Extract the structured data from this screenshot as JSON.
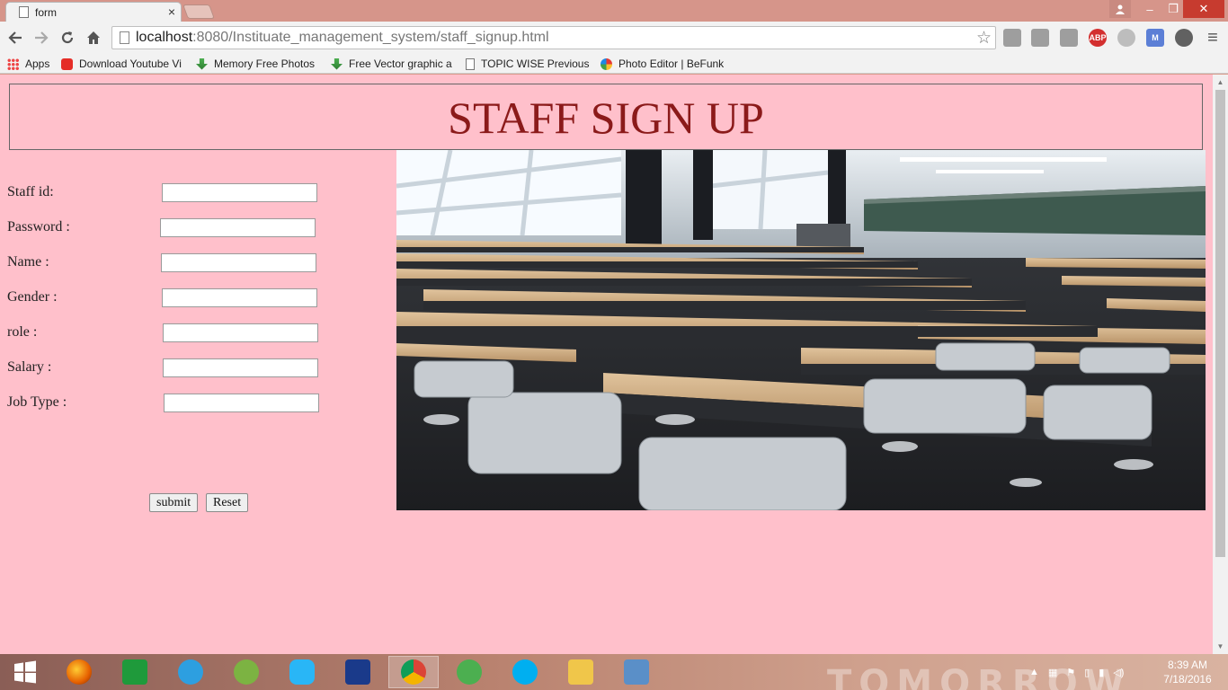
{
  "browser": {
    "tab_title": "form",
    "tab_close": "×",
    "url_host": "localhost",
    "url_path": ":8080/Instituate_management_system/staff_signup.html",
    "window_controls": {
      "minimize": "–",
      "maximize": "❐",
      "close": "✕"
    }
  },
  "bookmarks": [
    {
      "label": "Apps",
      "icon": "apps-icon"
    },
    {
      "label": "Download Youtube Vi",
      "icon": "youtube-icon"
    },
    {
      "label": "Memory Free Photos",
      "icon": "download-icon"
    },
    {
      "label": "Free Vector graphic a",
      "icon": "download-icon"
    },
    {
      "label": "TOPIC WISE Previous",
      "icon": "page-icon"
    },
    {
      "label": "Photo Editor | BeFunk",
      "icon": "befunky-icon"
    }
  ],
  "extensions": [
    {
      "name": "office-icon",
      "label": "",
      "color": "#9e9e9e"
    },
    {
      "name": "puzzle-icon",
      "label": "",
      "color": "#9e9e9e"
    },
    {
      "name": "puzzle-icon-2",
      "label": "",
      "color": "#9e9e9e"
    },
    {
      "name": "adblock-icon",
      "label": "ABP",
      "color": "#d32f2f"
    },
    {
      "name": "circle-extension-icon",
      "label": "",
      "color": "#bdbdbd"
    },
    {
      "name": "gmail-icon",
      "label": "M",
      "color": "#5c7fd6"
    },
    {
      "name": "globe-extension-icon",
      "label": "",
      "color": "#616161"
    }
  ],
  "page": {
    "heading": "STAFF SIGN UP",
    "fields": [
      {
        "label": "Staff id:",
        "value": ""
      },
      {
        "label": "Password :",
        "value": ""
      },
      {
        "label": "Name :",
        "value": ""
      },
      {
        "label": "Gender :",
        "value": ""
      },
      {
        "label": "role :",
        "value": ""
      },
      {
        "label": "Salary :",
        "value": ""
      },
      {
        "label": "Job Type :",
        "value": ""
      }
    ],
    "submit_label": "submit",
    "reset_label": "Reset",
    "background_color": "#ffc0cb",
    "heading_color": "#8b1a1a"
  },
  "taskbar": {
    "apps": [
      "windows-start-icon",
      "firefox-icon",
      "store-icon",
      "ie-icon",
      "android-studio-icon",
      "shareit-icon",
      "devcpp-icon",
      "chrome-icon",
      "utorrent-icon",
      "skype-icon",
      "file-explorer-icon",
      "virtualbox-icon"
    ],
    "time": "8:39 AM",
    "date": "7/18/2016",
    "watermark": "TOMORROW"
  }
}
